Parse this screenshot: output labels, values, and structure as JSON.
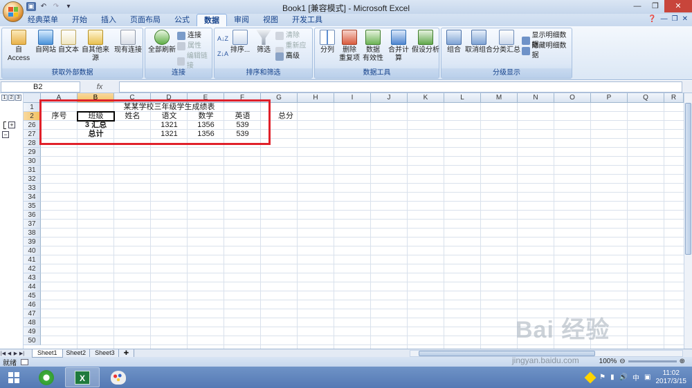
{
  "window": {
    "title": "Book1  [兼容模式] - Microsoft Excel"
  },
  "ribbon_tabs": [
    "经典菜单",
    "开始",
    "插入",
    "页面布局",
    "公式",
    "数据",
    "审阅",
    "视图",
    "开发工具"
  ],
  "ribbon": {
    "groups": [
      {
        "title": "获取外部数据",
        "buttons": [
          "自 Access",
          "自网站",
          "自文本",
          "自其他来源",
          "现有连接"
        ]
      },
      {
        "title": "连接",
        "buttons": [
          "全部刷新"
        ],
        "small": [
          "连接",
          "属性",
          "编辑链接"
        ]
      },
      {
        "title": "排序和筛选",
        "buttons": [
          "排序...",
          "筛选"
        ],
        "small": [
          "清除",
          "重新应用",
          "高级"
        ]
      },
      {
        "title": "数据工具",
        "buttons": [
          "分列",
          "删除\n重复项",
          "数据\n有效性",
          "合并计算",
          "假设分析"
        ]
      },
      {
        "title": "分级显示",
        "buttons": [
          "组合",
          "取消组合",
          "分类汇总"
        ],
        "small": [
          "显示明细数据",
          "隐藏明细数据"
        ]
      }
    ]
  },
  "formula_bar": {
    "name_box": "B2",
    "fx": "fx",
    "content": ""
  },
  "sheet": {
    "columns": [
      "A",
      "B",
      "C",
      "D",
      "E",
      "F",
      "G",
      "H",
      "I",
      "J",
      "K",
      "L",
      "M",
      "N",
      "O",
      "P",
      "Q",
      "R"
    ],
    "rows": [
      "1",
      "2",
      "26",
      "27",
      "28",
      "29",
      "30",
      "31",
      "32",
      "33",
      "34",
      "35",
      "36",
      "37",
      "38",
      "39",
      "40",
      "41",
      "42",
      "43",
      "44",
      "45",
      "46",
      "47",
      "48",
      "49",
      "50"
    ],
    "title": "某某学校三年级学生成绩表",
    "headers": [
      "序号",
      "班级",
      "姓名",
      "语文",
      "数学",
      "英语",
      "总分"
    ],
    "subtotal_row": {
      "label": "3 汇总",
      "chinese": "1321",
      "math": "1356",
      "english": "539"
    },
    "total_row": {
      "label": "总计",
      "chinese": "1321",
      "math": "1356",
      "english": "539"
    },
    "outline_levels": [
      "1",
      "2",
      "3"
    ]
  },
  "sheet_tabs": [
    "Sheet1",
    "Sheet2",
    "Sheet3"
  ],
  "status": {
    "mode": "就绪",
    "zoom": "100%"
  },
  "taskbar": {
    "time": "11:02",
    "date": "2017/3/15",
    "ime": "中"
  },
  "watermark": {
    "brand": "Bai 经验",
    "url": "jingyan.baidu.com"
  }
}
